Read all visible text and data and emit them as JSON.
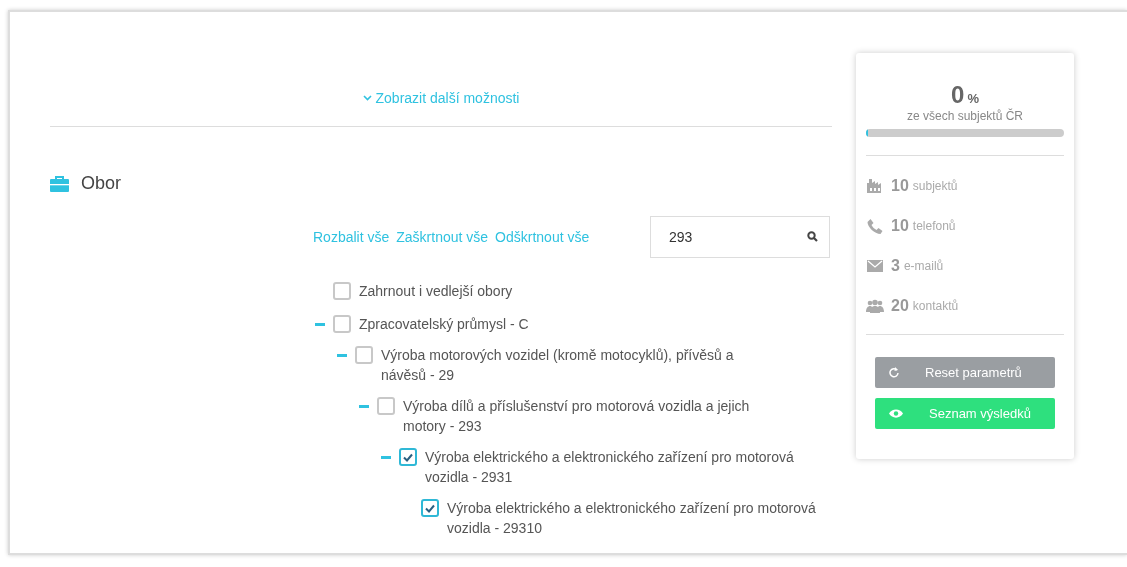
{
  "more_options_link": "Zobrazit další možnosti",
  "section": {
    "title": "Obor"
  },
  "tree_actions": [
    "Rozbalit vše",
    "Zaškrtnout vše",
    "Odškrtnout vše"
  ],
  "search": {
    "value": "293"
  },
  "include_secondary": {
    "label": "Zahrnout i vedlejší obory",
    "checked": false
  },
  "tree": [
    {
      "label": "Zpracovatelský průmysl - C",
      "checked": false,
      "expanded": true,
      "children": [
        {
          "label": "Výroba motorových vozidel (kromě motocyklů), přívěsů a návěsů - 29",
          "checked": false,
          "expanded": true,
          "children": [
            {
              "label": "Výroba dílů a příslušenství pro motorová vozidla a jejich motory - 293",
              "checked": false,
              "expanded": true,
              "children": [
                {
                  "label": "Výroba elektrického a elektronického zařízení pro motorová vozidla - 2931",
                  "checked": true,
                  "expanded": true,
                  "children": [
                    {
                      "label": "Výroba elektrického a elektronického zařízení pro motorová vozidla - 29310",
                      "checked": true
                    }
                  ]
                }
              ]
            }
          ]
        }
      ]
    }
  ],
  "summary": {
    "percent": "0",
    "percent_unit": "%",
    "caption": "ze všech subjektů ČR",
    "level": 0.01,
    "stats": [
      {
        "kind": "factory",
        "count": "10",
        "label": "subjektů"
      },
      {
        "kind": "phone",
        "count": "10",
        "label": "telefonů"
      },
      {
        "kind": "mail",
        "count": "3",
        "label": "e-mailů"
      },
      {
        "kind": "people",
        "count": "20",
        "label": "kontaktů"
      }
    ],
    "buttons": [
      {
        "kind": "reset",
        "label": "Reset parametrů"
      },
      {
        "kind": "results",
        "label": "Seznam výsledků"
      }
    ]
  }
}
